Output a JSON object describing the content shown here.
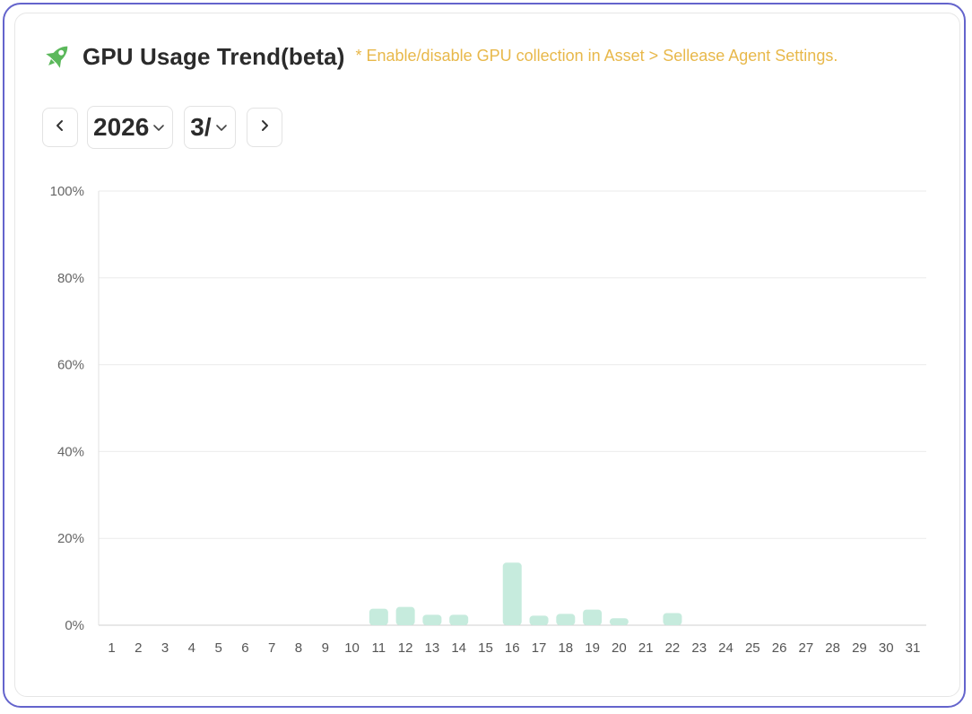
{
  "header": {
    "icon": "rocket-icon",
    "title": "GPU Usage Trend(beta)",
    "hint": "* Enable/disable GPU collection in Asset > Sellease Agent Settings."
  },
  "controls": {
    "prev_icon": "chevron-left-icon",
    "next_icon": "chevron-right-icon",
    "year": "2026",
    "month": "3/"
  },
  "colors": {
    "border": "#6464cc",
    "hint": "#e8b84a",
    "bar": "#c6ebdd",
    "rocket": "#5bb85b"
  },
  "chart_data": {
    "type": "bar",
    "y_tick_labels": [
      "0%",
      "20%",
      "40%",
      "60%",
      "80%",
      "100%"
    ],
    "ylim": [
      0,
      100
    ],
    "grid": true,
    "categories": [
      "1",
      "2",
      "3",
      "4",
      "5",
      "6",
      "7",
      "8",
      "9",
      "10",
      "11",
      "12",
      "13",
      "14",
      "15",
      "16",
      "17",
      "18",
      "19",
      "20",
      "21",
      "22",
      "23",
      "24",
      "25",
      "26",
      "27",
      "28",
      "29",
      "30",
      "31"
    ],
    "values": [
      0,
      0,
      0,
      0,
      0,
      0,
      0,
      0,
      0,
      0,
      3.8,
      4.2,
      2.4,
      2.4,
      0,
      14.4,
      2.2,
      2.6,
      3.6,
      1.6,
      0,
      2.8,
      0,
      0,
      0,
      0,
      0,
      0,
      0,
      0,
      0
    ]
  }
}
